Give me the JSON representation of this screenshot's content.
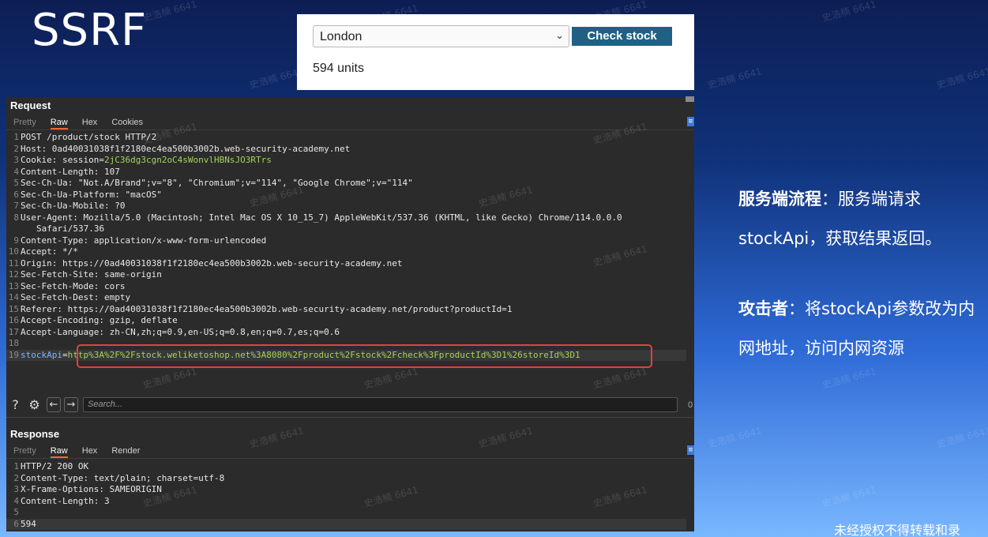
{
  "slide": {
    "title": "SSRF",
    "notes": [
      {
        "label": "服务端流程",
        "sep": "：",
        "text": "服务端请求stockApi，获取结果返回。"
      },
      {
        "label": "攻击者",
        "sep": "：",
        "text": "将stockApi参数改为内网地址，访问内网资源"
      }
    ],
    "footer": "未经授权不得转载和录"
  },
  "watermark": "史浩楠 6641",
  "stock_widget": {
    "selected_store": "London",
    "button_label": "Check stock",
    "result": "594 units"
  },
  "request": {
    "title": "Request",
    "tabs": [
      "Pretty",
      "Raw",
      "Hex",
      "Cookies"
    ],
    "active_tab": "Raw",
    "lines": [
      {
        "n": "1",
        "parts": [
          {
            "t": "POST /product/stock HTTP/2",
            "c": "code"
          }
        ]
      },
      {
        "n": "2",
        "parts": [
          {
            "t": "Host: ",
            "c": "code"
          },
          {
            "t": "0ad40031038f1f2180ec4ea500b3002b.web-security-academy.net",
            "c": "code"
          }
        ]
      },
      {
        "n": "3",
        "parts": [
          {
            "t": "Cookie: ",
            "c": "code"
          },
          {
            "t": "session=",
            "c": "code"
          },
          {
            "t": "2jC36dg3cgn2oC4sWonvlHBNsJO3RTrs",
            "c": "g"
          }
        ]
      },
      {
        "n": "4",
        "parts": [
          {
            "t": "Content-Length: ",
            "c": "code"
          },
          {
            "t": "107",
            "c": "code"
          }
        ]
      },
      {
        "n": "5",
        "parts": [
          {
            "t": "Sec-Ch-Ua: ",
            "c": "code"
          },
          {
            "t": "\"Not.A/Brand\";v=\"8\", \"Chromium\";v=\"114\", \"Google Chrome\";v=\"114\"",
            "c": "code"
          }
        ]
      },
      {
        "n": "6",
        "parts": [
          {
            "t": "Sec-Ch-Ua-Platform: ",
            "c": "code"
          },
          {
            "t": "\"macOS\"",
            "c": "code"
          }
        ]
      },
      {
        "n": "7",
        "parts": [
          {
            "t": "Sec-Ch-Ua-Mobile: ",
            "c": "code"
          },
          {
            "t": "?0",
            "c": "code"
          }
        ]
      },
      {
        "n": "8",
        "parts": [
          {
            "t": "User-Agent: ",
            "c": "code"
          },
          {
            "t": "Mozilla/5.0 (Macintosh; Intel Mac OS X 10_15_7) AppleWebKit/537.36 (KHTML, like Gecko) Chrome/114.0.0.0",
            "c": "code"
          }
        ]
      },
      {
        "n": "",
        "parts": [
          {
            "t": "Safari/537.36",
            "c": "code"
          }
        ]
      },
      {
        "n": "9",
        "parts": [
          {
            "t": "Content-Type: ",
            "c": "code"
          },
          {
            "t": "application/x-www-form-urlencoded",
            "c": "code"
          }
        ]
      },
      {
        "n": "10",
        "parts": [
          {
            "t": "Accept: ",
            "c": "code"
          },
          {
            "t": "*/*",
            "c": "code"
          }
        ]
      },
      {
        "n": "11",
        "parts": [
          {
            "t": "Origin: ",
            "c": "code"
          },
          {
            "t": "https://0ad40031038f1f2180ec4ea500b3002b.web-security-academy.net",
            "c": "code"
          }
        ]
      },
      {
        "n": "12",
        "parts": [
          {
            "t": "Sec-Fetch-Site: ",
            "c": "code"
          },
          {
            "t": "same-origin",
            "c": "code"
          }
        ]
      },
      {
        "n": "13",
        "parts": [
          {
            "t": "Sec-Fetch-Mode: ",
            "c": "code"
          },
          {
            "t": "cors",
            "c": "code"
          }
        ]
      },
      {
        "n": "14",
        "parts": [
          {
            "t": "Sec-Fetch-Dest: ",
            "c": "code"
          },
          {
            "t": "empty",
            "c": "code"
          }
        ]
      },
      {
        "n": "15",
        "parts": [
          {
            "t": "Referer: ",
            "c": "code"
          },
          {
            "t": "https://0ad40031038f1f2180ec4ea500b3002b.web-security-academy.net/product?productId=1",
            "c": "code"
          }
        ]
      },
      {
        "n": "16",
        "parts": [
          {
            "t": "Accept-Encoding: ",
            "c": "code"
          },
          {
            "t": "gzip, deflate",
            "c": "code"
          }
        ]
      },
      {
        "n": "17",
        "parts": [
          {
            "t": "Accept-Language: ",
            "c": "code"
          },
          {
            "t": "zh-CN,zh;q=0.9,en-US;q=0.8,en;q=0.7,es;q=0.6",
            "c": "code"
          }
        ]
      },
      {
        "n": "18",
        "parts": []
      },
      {
        "n": "19",
        "parts": [
          {
            "t": "stockApi",
            "c": "k"
          },
          {
            "t": "=",
            "c": "code"
          },
          {
            "t": "http%3A%2F%2Fstock.weliketoshop.net%3A8080%2Fproduct%2Fstock%2Fcheck%3FproductId%3D1%26storeId%3D1",
            "c": "g"
          }
        ],
        "highlight": true
      }
    ],
    "search_placeholder": "Search...",
    "match_count": "0"
  },
  "response": {
    "title": "Response",
    "tabs": [
      "Pretty",
      "Raw",
      "Hex",
      "Render"
    ],
    "active_tab": "Raw",
    "lines": [
      {
        "n": "1",
        "parts": [
          {
            "t": "HTTP/2 200 OK",
            "c": "code"
          }
        ]
      },
      {
        "n": "2",
        "parts": [
          {
            "t": "Content-Type: ",
            "c": "code"
          },
          {
            "t": "text/plain; charset=utf-8",
            "c": "code"
          }
        ]
      },
      {
        "n": "3",
        "parts": [
          {
            "t": "X-Frame-Options: ",
            "c": "code"
          },
          {
            "t": "SAMEORIGIN",
            "c": "code"
          }
        ]
      },
      {
        "n": "4",
        "parts": [
          {
            "t": "Content-Length: ",
            "c": "code"
          },
          {
            "t": "3",
            "c": "code"
          }
        ]
      },
      {
        "n": "5",
        "parts": []
      },
      {
        "n": "6",
        "parts": [
          {
            "t": "594",
            "c": "code"
          }
        ],
        "highlight": true
      }
    ]
  }
}
